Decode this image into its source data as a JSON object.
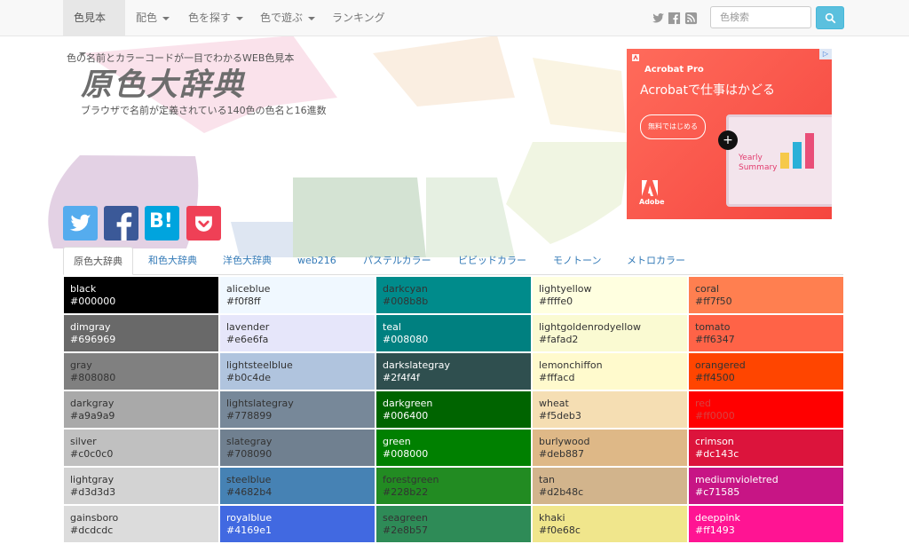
{
  "nav": {
    "items": [
      {
        "label": "色見本",
        "active": true,
        "dropdown": true
      },
      {
        "label": "配色",
        "active": false,
        "dropdown": true
      },
      {
        "label": "色を探す",
        "active": false,
        "dropdown": true
      },
      {
        "label": "色で遊ぶ",
        "active": false,
        "dropdown": true
      },
      {
        "label": "ランキング",
        "active": false,
        "dropdown": false
      }
    ],
    "search_placeholder": "色検索",
    "social_icons": [
      "twitter-icon",
      "facebook-icon",
      "rss-icon"
    ]
  },
  "header": {
    "tagline": "色の名前とカラーコードが一目でわかるWEB色見本",
    "logo": "原色大辞典",
    "subtitle": "ブラウザで名前が定義されている140色の色名と16進数"
  },
  "ad": {
    "product": "Acrobat Pro",
    "headline": "Acrobatで仕事はかどる",
    "cta": "無料ではじめる",
    "brand": "Adobe",
    "slide_text": "Yearly Summary",
    "colors": {
      "bg": "#f5463f"
    }
  },
  "share": [
    {
      "icon": "twitter-icon",
      "color": "#55acee"
    },
    {
      "icon": "facebook-icon",
      "color": "#3b5998"
    },
    {
      "icon": "hatena-icon",
      "color": "#00a4de"
    },
    {
      "icon": "pocket-icon",
      "color": "#ef4056"
    }
  ],
  "tabs": [
    "原色大辞典",
    "和色大辞典",
    "洋色大辞典",
    "web216",
    "パステルカラー",
    "ビビッドカラー",
    "モノトーン",
    "メトロカラー"
  ],
  "active_tab": 0,
  "colors": [
    [
      {
        "name": "black",
        "code": "#000000",
        "text": "#ffffff"
      },
      {
        "name": "dimgray",
        "code": "#696969",
        "text": "#ffffff"
      },
      {
        "name": "gray",
        "code": "#808080",
        "text": "#333333"
      },
      {
        "name": "darkgray",
        "code": "#a9a9a9",
        "text": "#333333"
      },
      {
        "name": "silver",
        "code": "#c0c0c0",
        "text": "#333333"
      },
      {
        "name": "lightgray",
        "code": "#d3d3d3",
        "text": "#333333"
      },
      {
        "name": "gainsboro",
        "code": "#dcdcdc",
        "text": "#333333"
      }
    ],
    [
      {
        "name": "aliceblue",
        "code": "#f0f8ff",
        "text": "#333333"
      },
      {
        "name": "lavender",
        "code": "#e6e6fa",
        "text": "#333333"
      },
      {
        "name": "lightsteelblue",
        "code": "#b0c4de",
        "text": "#333333"
      },
      {
        "name": "lightslategray",
        "code": "#778899",
        "text": "#333333"
      },
      {
        "name": "slategray",
        "code": "#708090",
        "text": "#333333"
      },
      {
        "name": "steelblue",
        "code": "#4682b4",
        "text": "#333333"
      },
      {
        "name": "royalblue",
        "code": "#4169e1",
        "text": "#ffffff"
      }
    ],
    [
      {
        "name": "darkcyan",
        "code": "#008b8b",
        "text": "#333333"
      },
      {
        "name": "teal",
        "code": "#008080",
        "text": "#ffffff"
      },
      {
        "name": "darkslategray",
        "code": "#2f4f4f",
        "text": "#ffffff"
      },
      {
        "name": "darkgreen",
        "code": "#006400",
        "text": "#ffffff"
      },
      {
        "name": "green",
        "code": "#008000",
        "text": "#ffffff"
      },
      {
        "name": "forestgreen",
        "code": "#228b22",
        "text": "#333333"
      },
      {
        "name": "seagreen",
        "code": "#2e8b57",
        "text": "#333333"
      }
    ],
    [
      {
        "name": "lightyellow",
        "code": "#ffffe0",
        "text": "#333333"
      },
      {
        "name": "lightgoldenrodyellow",
        "code": "#fafad2",
        "text": "#333333"
      },
      {
        "name": "lemonchiffon",
        "code": "#fffacd",
        "text": "#333333"
      },
      {
        "name": "wheat",
        "code": "#f5deb3",
        "text": "#333333"
      },
      {
        "name": "burlywood",
        "code": "#deb887",
        "text": "#333333"
      },
      {
        "name": "tan",
        "code": "#d2b48c",
        "text": "#333333"
      },
      {
        "name": "khaki",
        "code": "#f0e68c",
        "text": "#333333"
      }
    ],
    [
      {
        "name": "coral",
        "code": "#ff7f50",
        "text": "#333333"
      },
      {
        "name": "tomato",
        "code": "#ff6347",
        "text": "#333333"
      },
      {
        "name": "orangered",
        "code": "#ff4500",
        "text": "#333333"
      },
      {
        "name": "red",
        "code": "#ff0000",
        "text": "#d84040"
      },
      {
        "name": "crimson",
        "code": "#dc143c",
        "text": "#ffffff"
      },
      {
        "name": "mediumvioletred",
        "code": "#c71585",
        "text": "#ffffff"
      },
      {
        "name": "deeppink",
        "code": "#ff1493",
        "text": "#ffffff"
      }
    ]
  ]
}
